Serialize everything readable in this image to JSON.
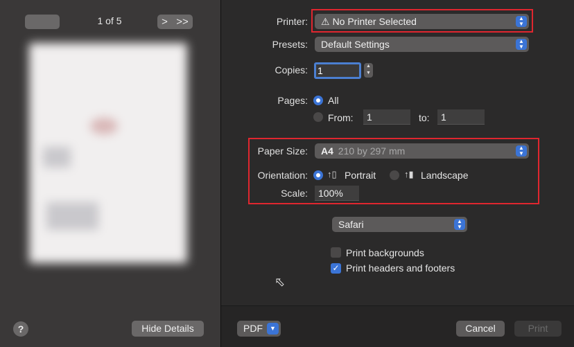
{
  "preview": {
    "page_indicator": "1 of 5",
    "next_label": ">",
    "last_label": ">>",
    "help_label": "?",
    "hide_details_label": "Hide Details"
  },
  "printer": {
    "label": "Printer:",
    "value": "No Printer Selected",
    "warning_icon": "warning-triangle-icon"
  },
  "presets": {
    "label": "Presets:",
    "value": "Default Settings"
  },
  "copies": {
    "label": "Copies:",
    "value": "1"
  },
  "pages": {
    "label": "Pages:",
    "all_label": "All",
    "from_label": "From:",
    "from_value": "1",
    "to_label": "to:",
    "to_value": "1",
    "selected": "All"
  },
  "paper": {
    "label": "Paper Size:",
    "value_bold": "A4",
    "value_dims": "210 by 297 mm"
  },
  "orientation": {
    "label": "Orientation:",
    "portrait_label": "Portrait",
    "landscape_label": "Landscape",
    "selected": "Portrait"
  },
  "scale": {
    "label": "Scale:",
    "value": "100%"
  },
  "app_section": {
    "value": "Safari",
    "print_backgrounds_label": "Print backgrounds",
    "print_backgrounds_checked": false,
    "print_headers_label": "Print headers and footers",
    "print_headers_checked": true
  },
  "footer": {
    "pdf_label": "PDF",
    "cancel_label": "Cancel",
    "print_label": "Print"
  },
  "colors": {
    "accent": "#3b74d6",
    "highlight_border": "#e0262f",
    "panel_right": "#2b2a2a",
    "panel_left": "#3a3838"
  }
}
